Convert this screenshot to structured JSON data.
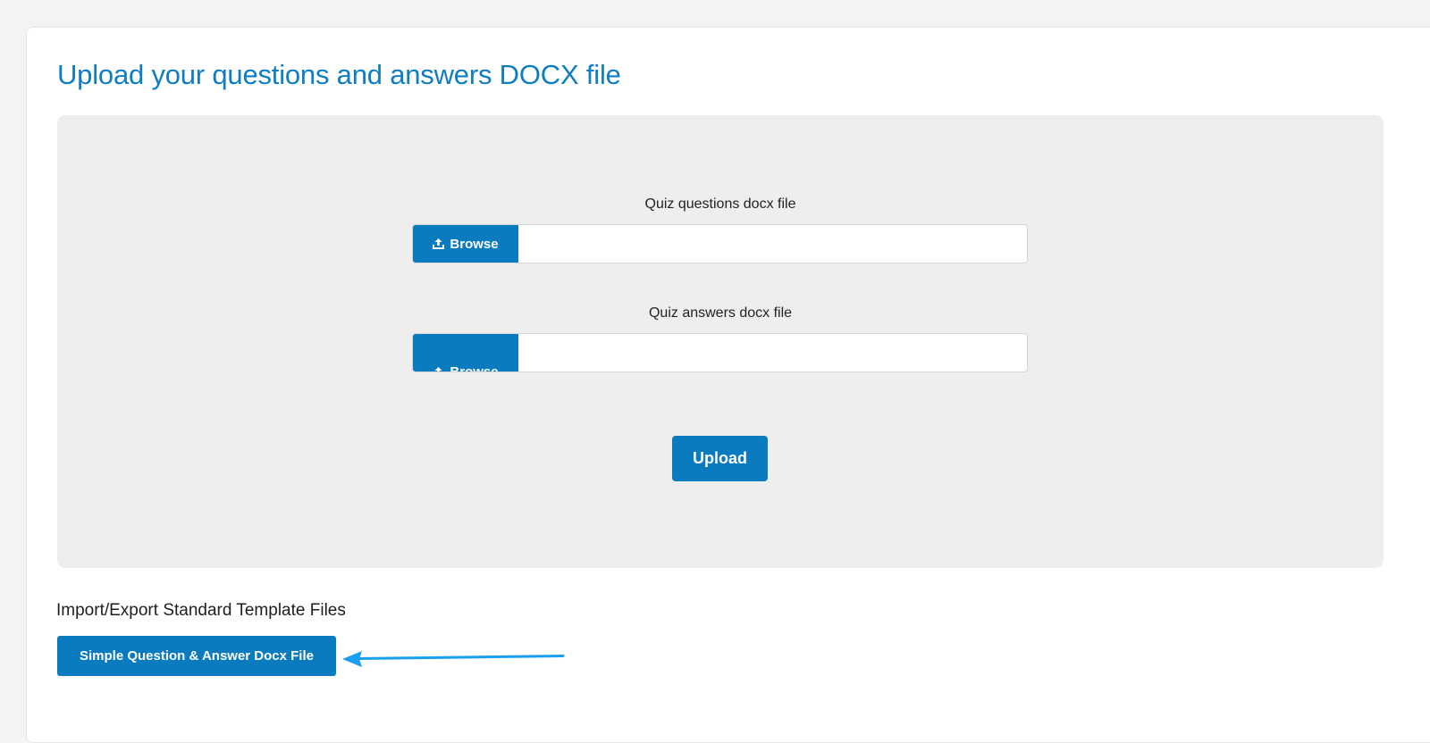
{
  "page_title": "Upload your questions and answers DOCX file",
  "upload_form": {
    "questions_field": {
      "label": "Quiz questions docx file",
      "browse_label": "Browse",
      "value": ""
    },
    "answers_field": {
      "label": "Quiz answers docx file",
      "browse_label": "Browse",
      "value": ""
    },
    "upload_label": "Upload"
  },
  "templates": {
    "heading": "Import/Export Standard Template Files",
    "simple_qa_label": "Simple Question & Answer Docx File"
  },
  "icons": {
    "browse": "upload-icon",
    "annotation": "arrow-left-icon"
  },
  "colors": {
    "accent": "#0a7bbf",
    "title": "#0e7dc2",
    "annotation_arrow": "#1a9ff0",
    "panel_bg": "#eeeeee"
  }
}
